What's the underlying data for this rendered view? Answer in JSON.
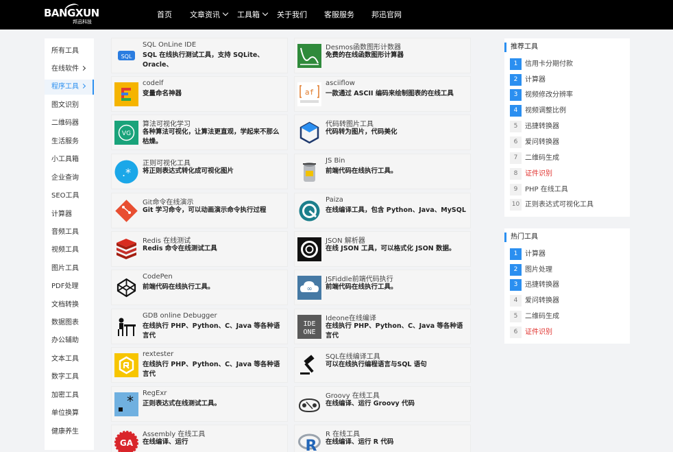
{
  "header": {
    "logo_text": "BANGXUN",
    "logo_subtitle": "邦迅科技",
    "nav": [
      {
        "label": "首页"
      },
      {
        "label": "文章资讯"
      },
      {
        "label": "工具箱"
      },
      {
        "label": "关于我们"
      },
      {
        "label": "客服服务"
      },
      {
        "label": "邦迅官网"
      }
    ]
  },
  "sidebar": {
    "items": [
      {
        "label": "所有工具"
      },
      {
        "label": "在线软件"
      },
      {
        "label": "程序工具"
      },
      {
        "label": "图文识别"
      },
      {
        "label": "二维码器"
      },
      {
        "label": "生活服务"
      },
      {
        "label": "小工具箱"
      },
      {
        "label": "企业查询"
      },
      {
        "label": "SEO工具"
      },
      {
        "label": "计算器"
      },
      {
        "label": "音频工具"
      },
      {
        "label": "视频工具"
      },
      {
        "label": "图片工具"
      },
      {
        "label": "PDF处理"
      },
      {
        "label": "文档转换"
      },
      {
        "label": "数据图表"
      },
      {
        "label": "办公辅助"
      },
      {
        "label": "文本工具"
      },
      {
        "label": "数字工具"
      },
      {
        "label": "加密工具"
      },
      {
        "label": "单位换算"
      },
      {
        "label": "健康养生"
      }
    ]
  },
  "tools": {
    "left": [
      {
        "title": "SQL OnLine IDE",
        "desc": "SQL 在线执行测试工具，支持 SQLite、Oracle、",
        "icon": "sql-icon",
        "icon_text": "SQL"
      },
      {
        "title": "codelf",
        "desc": "变量命名神器",
        "icon": "codelf-icon",
        "icon_text": ""
      },
      {
        "title": "算法可视化学习",
        "desc": "各种算法可视化，让算法更直观，学起来不那么枯燥。",
        "icon": "vg-icon",
        "icon_text": "VG"
      },
      {
        "title": "正则可视化工具",
        "desc": "将正则表达式转化成可视化图片",
        "icon": "regex-visual-icon",
        "icon_text": ".*"
      },
      {
        "title": "Git命令在线演示",
        "desc": "Git 学习命令，可以动画演示命令执行过程",
        "icon": "git-icon",
        "icon_text": ""
      },
      {
        "title": "Redis 在线测试",
        "desc": "Redis 命令在线测试工具",
        "icon": "redis-icon",
        "icon_text": ""
      },
      {
        "title": "CodePen",
        "desc": "前端代码在线执行工具。",
        "icon": "codepen-icon",
        "icon_text": ""
      },
      {
        "title": "GDB online Debugger",
        "desc": "在线执行 PHP、Python、C、Java 等各种语言代",
        "icon": "gdb-icon",
        "icon_text": ""
      },
      {
        "title": "rextester",
        "desc": "在线执行 PHP、Python、C、Java 等各种语言代",
        "icon": "rextester-icon",
        "icon_text": ""
      },
      {
        "title": "RegExr",
        "desc": "正则表达式在线测试工具。",
        "icon": "regexr-icon",
        "icon_text": "*"
      },
      {
        "title": "Assembly 在线工具",
        "desc": "在线编译、运行",
        "icon": "assembly-icon",
        "icon_text": "GA"
      }
    ],
    "right": [
      {
        "title": "Desmos函数图形计数器",
        "desc": "免费的在线函数图形计算器",
        "icon": "desmos-icon",
        "icon_text": ""
      },
      {
        "title": "asciiflow",
        "desc": "一款通过 ASCII 编码来绘制图表的在线工具",
        "icon": "asciiflow-icon",
        "icon_text": "af"
      },
      {
        "title": "代码转图片工具",
        "desc": "代码转为图片，代码美化",
        "icon": "code-image-icon",
        "icon_text": ""
      },
      {
        "title": "JS Bin",
        "desc": "前端代码在线执行工具。",
        "icon": "jsbin-icon",
        "icon_text": ""
      },
      {
        "title": "Paiza",
        "desc": "在线编译工具，包含 Python、Java、MySQL",
        "icon": "paiza-icon",
        "icon_text": ""
      },
      {
        "title": "JSON 解析器",
        "desc": "在线 JSON 工具，可以格式化 JSON 数据。",
        "icon": "json-icon",
        "icon_text": ""
      },
      {
        "title": "JSFiddle前端代码执行",
        "desc": "前端代码在线执行工具。",
        "icon": "jsfiddle-icon",
        "icon_text": "∞"
      },
      {
        "title": "Ideone在线编译",
        "desc": "在线执行 PHP、Python、C、Java 等各种语言代",
        "icon": "ideone-icon",
        "icon_text": "IDE ONE"
      },
      {
        "title": "SQL在线编译工具",
        "desc": "可以在线执行编程语言与SQL 语句",
        "icon": "sql-compiler-icon",
        "icon_text": ""
      },
      {
        "title": "Groovy 在线工具",
        "desc": "在线编译、运行 Groovy 代码",
        "icon": "groovy-icon",
        "icon_text": ""
      },
      {
        "title": "R 在线工具",
        "desc": "在线编译、运行 R 代码",
        "icon": "r-icon",
        "icon_text": "R"
      }
    ]
  },
  "recommended": {
    "title": "推荐工具",
    "items": [
      {
        "num": "1",
        "label": "信用卡分期付款"
      },
      {
        "num": "2",
        "label": "计算器"
      },
      {
        "num": "3",
        "label": "视频修改分辨率"
      },
      {
        "num": "4",
        "label": "视频调整比例"
      },
      {
        "num": "5",
        "label": "迅捷转换器"
      },
      {
        "num": "6",
        "label": "爱问转换器"
      },
      {
        "num": "7",
        "label": "二维码生成"
      },
      {
        "num": "8",
        "label": "证件识别"
      },
      {
        "num": "9",
        "label": "PHP 在线工具"
      },
      {
        "num": "10",
        "label": "正则表达式可视化工具"
      }
    ]
  },
  "hot": {
    "title": "热门工具",
    "items": [
      {
        "num": "1",
        "label": "计算器"
      },
      {
        "num": "2",
        "label": "图片处理"
      },
      {
        "num": "3",
        "label": "迅捷转换器"
      },
      {
        "num": "4",
        "label": "爱问转换器"
      },
      {
        "num": "5",
        "label": "二维码生成"
      },
      {
        "num": "6",
        "label": "证件识别"
      }
    ]
  },
  "colors": {
    "accent": "#2b8ff0",
    "highlight_red": "#e0322e",
    "header_bg": "#000000"
  }
}
